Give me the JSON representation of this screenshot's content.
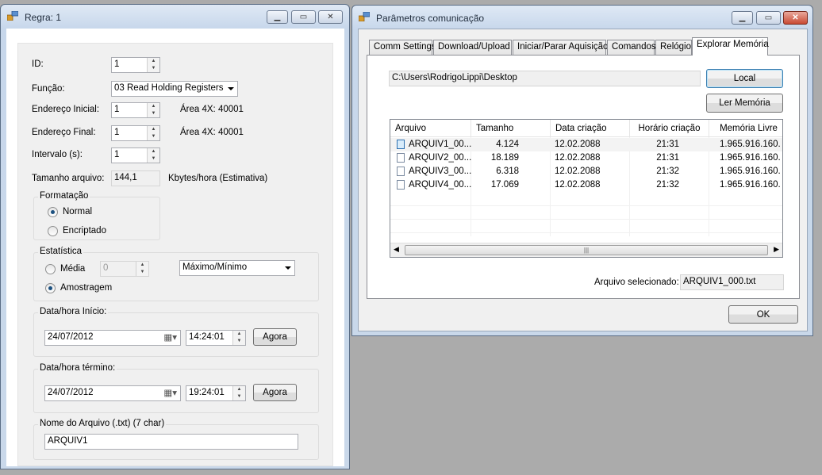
{
  "regra": {
    "title": "Regra: 1",
    "id": {
      "label": "ID:",
      "value": "1"
    },
    "funcao": {
      "label": "Função:",
      "value": "03 Read Holding Registers"
    },
    "end_inicial": {
      "label": "Endereço Inicial:",
      "value": "1",
      "info": "Área 4X: 40001"
    },
    "end_final": {
      "label": "Endereço Final:",
      "value": "1",
      "info": "Área 4X: 40001"
    },
    "intervalo": {
      "label": "Intervalo (s):",
      "value": "1"
    },
    "tamanho": {
      "label": "Tamanho arquivo:",
      "value": "144,1",
      "unit": "Kbytes/hora (Estimativa)"
    },
    "formatacao": {
      "title": "Formatação",
      "normal": "Normal",
      "encriptado": "Encriptado",
      "selected": "Normal"
    },
    "estatistica": {
      "title": "Estatística",
      "media": "Média",
      "media_value": "0",
      "amostragem": "Amostragem",
      "modo": "Máximo/Mínimo",
      "selected": "Amostragem"
    },
    "inicio": {
      "title": "Data/hora Início:",
      "date": "24/07/2012",
      "time": "14:24:01",
      "button": "Agora"
    },
    "termino": {
      "title": "Data/hora término:",
      "date": "24/07/2012",
      "time": "19:24:01",
      "button": "Agora"
    },
    "nome": {
      "title": "Nome do Arquivo (.txt) (7 char)",
      "value": "ARQUIV1"
    }
  },
  "params": {
    "title": "Parâmetros comunicação",
    "tabs": [
      "Comm Settings",
      "Download/Upload",
      "Iniciar/Parar Aquisição",
      "Comandos",
      "Relógio",
      "Explorar Memória"
    ],
    "active_tab": "Explorar Memória",
    "path": "C:\\Users\\RodrigoLippi\\Desktop",
    "local_button": "Local",
    "ler_button": "Ler Memória",
    "columns": [
      "Arquivo",
      "Tamanho",
      "Data criação",
      "Horário criação",
      "Memória Livre"
    ],
    "rows": [
      [
        "ARQUIV1_00...",
        "4.124",
        "12.02.2088",
        "21:31",
        "1.965.916.160."
      ],
      [
        "ARQUIV2_00...",
        "18.189",
        "12.02.2088",
        "21:31",
        "1.965.916.160."
      ],
      [
        "ARQUIV3_00...",
        "6.318",
        "12.02.2088",
        "21:32",
        "1.965.916.160."
      ],
      [
        "ARQUIV4_00...",
        "17.069",
        "12.02.2088",
        "21:32",
        "1.965.916.160."
      ]
    ],
    "selected_label": "Arquivo selecionado:",
    "selected_value": "ARQUIV1_000.txt",
    "ok_button": "OK"
  }
}
